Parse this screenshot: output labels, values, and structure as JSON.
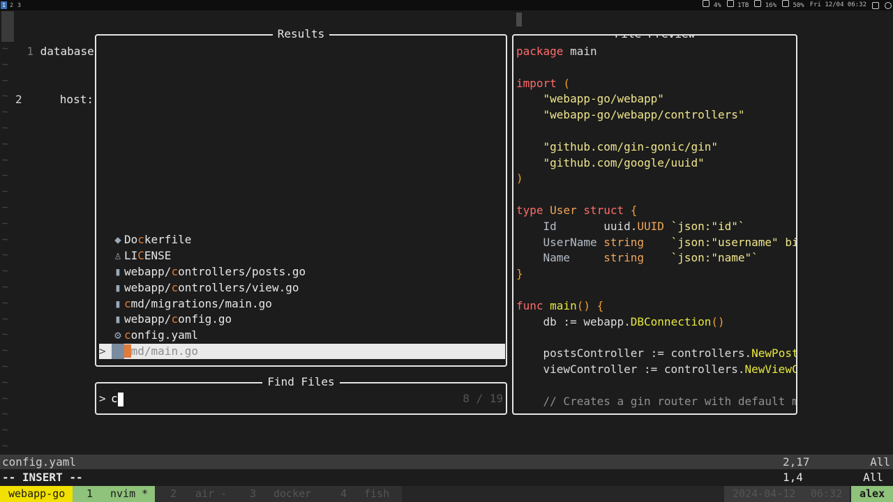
{
  "topbar": {
    "workspaces": [
      "1",
      "2",
      "3"
    ],
    "status": [
      {
        "icon": "cpu-icon",
        "text": "4%"
      },
      {
        "icon": "disk-icon",
        "text": "1TB"
      },
      {
        "icon": "memory-icon",
        "text": "16%"
      },
      {
        "icon": "volume-icon",
        "text": "50%"
      }
    ],
    "clock": "Fri 12/04 06:32"
  },
  "editor": {
    "lines": [
      {
        "num": "1",
        "text": "database:"
      },
      {
        "num": "2",
        "text": "  host: l"
      }
    ],
    "tilde": "~"
  },
  "results": {
    "title": "Results",
    "items": [
      {
        "icon": "docker-icon",
        "pre": "Do",
        "hl": "c",
        "post": "kerfile",
        "selected": false
      },
      {
        "icon": "license-icon",
        "pre": "LI",
        "hl": "C",
        "post": "ENSE",
        "selected": false
      },
      {
        "icon": "go-file-icon",
        "pre": "webapp/",
        "hl": "c",
        "post": "ontrollers/posts.go",
        "selected": false
      },
      {
        "icon": "go-file-icon",
        "pre": "webapp/",
        "hl": "c",
        "post": "ontrollers/view.go",
        "selected": false
      },
      {
        "icon": "go-file-icon",
        "pre": "",
        "hl": "c",
        "post": "md/migrations/main.go",
        "selected": false
      },
      {
        "icon": "go-file-icon",
        "pre": "webapp/",
        "hl": "c",
        "post": "onfig.go",
        "selected": false
      },
      {
        "icon": "gear-icon",
        "pre": "",
        "hl": "c",
        "post": "onfig.yaml",
        "selected": false
      },
      {
        "icon": "go-file-icon",
        "pre": "",
        "hl": "c",
        "post": "md/main.go",
        "selected": true
      }
    ],
    "selection_caret": ">"
  },
  "find": {
    "title": "Find Files",
    "prompt": ">",
    "query": "c",
    "count": "8 / 19"
  },
  "preview": {
    "title": "File Preview",
    "lines": [
      [
        [
          "kw",
          "package"
        ],
        [
          "plain",
          " main"
        ]
      ],
      [],
      [
        [
          "kw",
          "import"
        ],
        [
          "pun",
          " ("
        ]
      ],
      [
        [
          "plain",
          "    "
        ],
        [
          "str",
          "\"webapp-go/webapp\""
        ]
      ],
      [
        [
          "plain",
          "    "
        ],
        [
          "str",
          "\"webapp-go/webapp/controllers\""
        ]
      ],
      [],
      [
        [
          "plain",
          "    "
        ],
        [
          "str",
          "\"github.com/gin-gonic/gin\""
        ]
      ],
      [
        [
          "plain",
          "    "
        ],
        [
          "str",
          "\"github.com/google/uuid\""
        ]
      ],
      [
        [
          "pun",
          ")"
        ]
      ],
      [],
      [
        [
          "kw",
          "type"
        ],
        [
          "plain",
          " "
        ],
        [
          "typ",
          "User"
        ],
        [
          "plain",
          " "
        ],
        [
          "kw",
          "struct"
        ],
        [
          "pun",
          " {"
        ]
      ],
      [
        [
          "plain",
          "    "
        ],
        [
          "fld",
          "Id"
        ],
        [
          "plain",
          "       uuid."
        ],
        [
          "typ",
          "UUID"
        ],
        [
          "plain",
          " "
        ],
        [
          "str",
          "`json:\"id\"`"
        ]
      ],
      [
        [
          "plain",
          "    "
        ],
        [
          "fld",
          "UserName"
        ],
        [
          "plain",
          " "
        ],
        [
          "typ",
          "string"
        ],
        [
          "plain",
          "    "
        ],
        [
          "str",
          "`json:\"username\" bindin"
        ]
      ],
      [
        [
          "plain",
          "    "
        ],
        [
          "fld",
          "Name"
        ],
        [
          "plain",
          "     "
        ],
        [
          "typ",
          "string"
        ],
        [
          "plain",
          "    "
        ],
        [
          "str",
          "`json:\"name\"`"
        ]
      ],
      [
        [
          "pun",
          "}"
        ]
      ],
      [],
      [
        [
          "kw",
          "func"
        ],
        [
          "plain",
          " "
        ],
        [
          "fn",
          "main"
        ],
        [
          "pun",
          "() {"
        ]
      ],
      [
        [
          "plain",
          "    db := webapp."
        ],
        [
          "fn",
          "DBConnection"
        ],
        [
          "pun",
          "()"
        ]
      ],
      [],
      [
        [
          "plain",
          "    postsController := controllers."
        ],
        [
          "fn",
          "NewPostsCon"
        ]
      ],
      [
        [
          "plain",
          "    viewController := controllers."
        ],
        [
          "fn",
          "NewViewContr"
        ]
      ],
      [],
      [
        [
          "cmt",
          "    // Creates a gin router with default middl"
        ]
      ]
    ]
  },
  "statusline": {
    "file": "config.yaml",
    "position": "2,17",
    "scroll": "All"
  },
  "modeline": {
    "mode": "-- INSERT --",
    "position": "1,4",
    "scroll": "All"
  },
  "tmux": {
    "session": "webapp-go",
    "windows": [
      {
        "index": "1",
        "name": "nvim *",
        "active": true
      },
      {
        "index": "2",
        "name": "air -",
        "active": false
      },
      {
        "index": "3",
        "name": "docker",
        "active": false
      },
      {
        "index": "4",
        "name": "fish",
        "active": false
      }
    ],
    "date": "2024-04-12",
    "time": "06:32",
    "user": "alex"
  },
  "colors": {
    "accent_yellow": "#f2e000",
    "accent_green": "#8fc27a",
    "highlight_orange": "#e07b39",
    "window_green": "#7ea86a"
  }
}
